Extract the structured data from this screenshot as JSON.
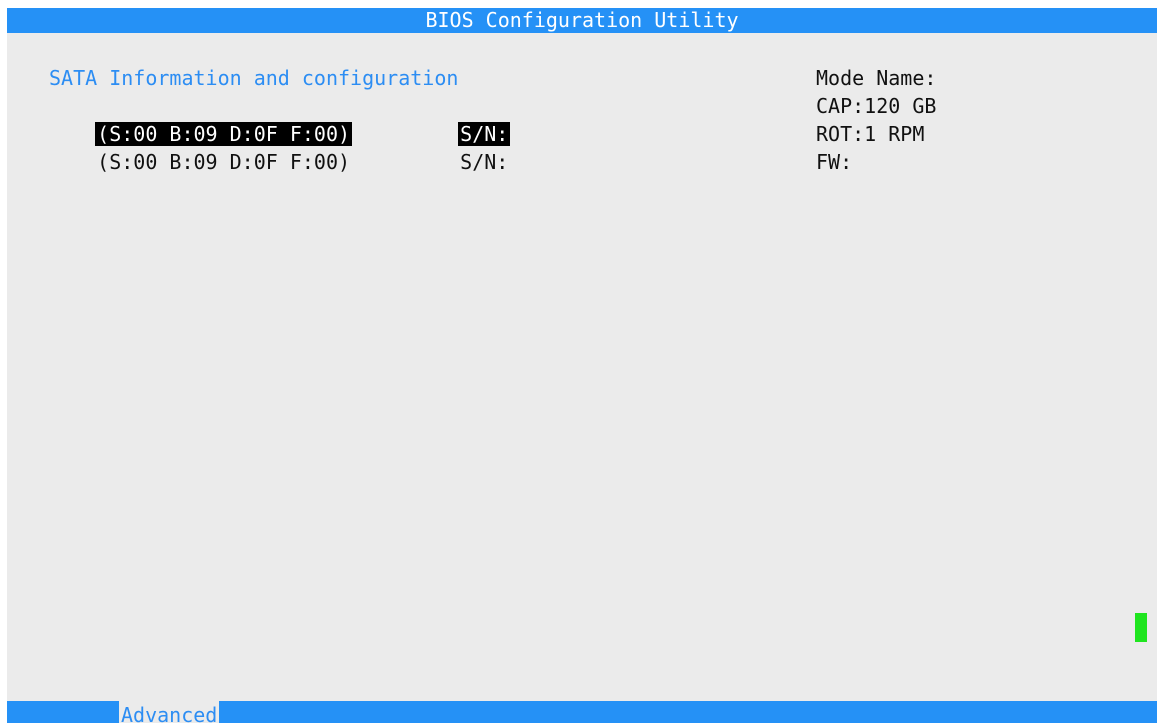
{
  "title": "BIOS Configuration Utility",
  "section": {
    "heading": "SATA Information and configuration"
  },
  "devices": [
    {
      "location": "(S:00 B:09 D:0F F:00)",
      "serial_label": "S/N:"
    },
    {
      "location": "(S:00 B:09 D:0F F:00)",
      "serial_label": "S/N:"
    }
  ],
  "details": {
    "mode_name": "Mode Name:",
    "capacity": "CAP:120 GB",
    "rotation": "ROT:1 RPM",
    "firmware": "FW:"
  },
  "bottom_menu": {
    "active_tab": "Advanced"
  },
  "colors": {
    "title_bar": "#2591f6",
    "background": "#ebebeb",
    "heading_text": "#2c8df3",
    "selection": "#000000",
    "cursor": "#1fe51f"
  }
}
